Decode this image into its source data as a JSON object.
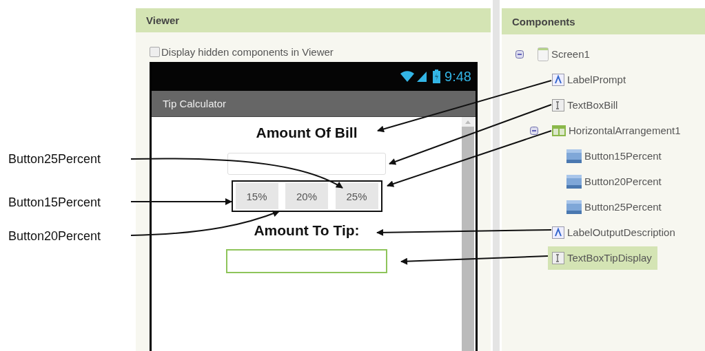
{
  "callouts": [
    {
      "text": "Button25Percent"
    },
    {
      "text": "Button15Percent"
    },
    {
      "text": "Button20Percent"
    }
  ],
  "viewer": {
    "title": "Viewer",
    "hidden_checkbox": {
      "label": "Display hidden components in Viewer",
      "checked": false
    },
    "phone": {
      "time": "9:48",
      "app_title": "Tip Calculator",
      "screen": [
        {
          "kind": "label",
          "text": "Amount Of Bill"
        },
        {
          "kind": "textbox",
          "focused": false
        },
        {
          "kind": "arrangement",
          "buttons": [
            "15%",
            "20%",
            "25%"
          ]
        },
        {
          "kind": "label",
          "text": "Amount To Tip:"
        },
        {
          "kind": "textbox",
          "focused": true
        }
      ]
    }
  },
  "components": {
    "title": "Components",
    "tree": [
      {
        "name": "Screen1",
        "kind": "screen",
        "expanded": true,
        "selected": false,
        "children": [
          {
            "name": "LabelPrompt",
            "kind": "label",
            "selected": false
          },
          {
            "name": "TextBoxBill",
            "kind": "textbox",
            "selected": false
          },
          {
            "name": "HorizontalArrangement1",
            "kind": "arrangement",
            "expanded": true,
            "selected": false,
            "children": [
              {
                "name": "Button15Percent",
                "kind": "button",
                "selected": false
              },
              {
                "name": "Button20Percent",
                "kind": "button",
                "selected": false
              },
              {
                "name": "Button25Percent",
                "kind": "button",
                "selected": false
              }
            ]
          },
          {
            "name": "LabelOutputDescription",
            "kind": "label",
            "selected": false
          },
          {
            "name": "TextBoxTipDisplay",
            "kind": "textbox",
            "selected": true
          }
        ]
      }
    ]
  }
}
